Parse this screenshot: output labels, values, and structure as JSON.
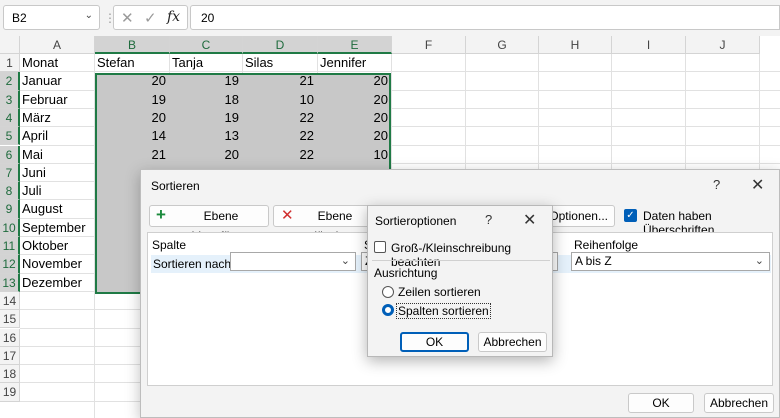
{
  "formula_bar": {
    "name_box": "B2",
    "formula": "20",
    "cancel_icon": "✕",
    "enter_icon": "✓",
    "fx_label": "fx"
  },
  "grid": {
    "columns": [
      "A",
      "B",
      "C",
      "D",
      "E",
      "F",
      "G",
      "H",
      "I",
      "J"
    ],
    "selected_columns": [
      "B",
      "C",
      "D",
      "E"
    ],
    "rows": [
      "1",
      "2",
      "3",
      "4",
      "5",
      "6",
      "7",
      "8",
      "9",
      "10",
      "11",
      "12",
      "13",
      "14",
      "15",
      "16",
      "17",
      "18",
      "19"
    ],
    "headers": [
      "Monat",
      "Stefan",
      "Tanja",
      "Silas",
      "Jennifer"
    ],
    "data": [
      {
        "month": "Januar",
        "values": [
          "20",
          "19",
          "21",
          "20"
        ]
      },
      {
        "month": "Februar",
        "values": [
          "19",
          "18",
          "10",
          "20"
        ]
      },
      {
        "month": "März",
        "values": [
          "20",
          "19",
          "22",
          "20"
        ]
      },
      {
        "month": "April",
        "values": [
          "14",
          "13",
          "22",
          "20"
        ]
      },
      {
        "month": "Mai",
        "values": [
          "21",
          "20",
          "22",
          "10"
        ]
      },
      {
        "month": "Juni",
        "values": []
      },
      {
        "month": "Juli",
        "values": []
      },
      {
        "month": "August",
        "values": []
      },
      {
        "month": "September",
        "values": []
      },
      {
        "month": "Oktober",
        "values": []
      },
      {
        "month": "November",
        "values": []
      },
      {
        "month": "Dezember",
        "values": []
      }
    ]
  },
  "sort_dialog": {
    "title": "Sortieren",
    "help": "?",
    "close": "✕",
    "add_level": "Ebene hinzufügen",
    "delete_level": "Ebene löschen",
    "options": "Optionen...",
    "has_headers_label": "Daten haben Überschriften",
    "has_headers_checked": true,
    "column_header": "Spalte",
    "sort_on_header": "S",
    "order_header": "Reihenfolge",
    "sort_by_label": "Sortieren nach",
    "sort_by_value": "",
    "sort_on_value": "Z",
    "order_value": "A bis Z",
    "ok": "OK",
    "cancel": "Abbrechen"
  },
  "options_dialog": {
    "title": "Sortieroptionen",
    "help": "?",
    "close": "✕",
    "case_sensitive_label": "Groß-/Kleinschreibung beachten",
    "case_sensitive_checked": false,
    "orientation_label": "Ausrichtung",
    "sort_rows_label": "Zeilen sortieren",
    "sort_columns_label": "Spalten sortieren",
    "selected_orientation": "columns",
    "ok": "OK",
    "cancel": "Abbrechen"
  }
}
